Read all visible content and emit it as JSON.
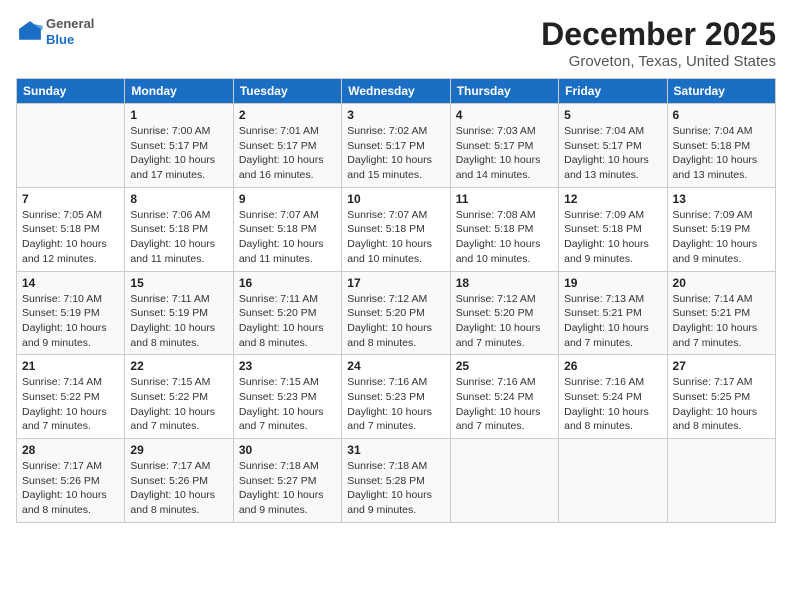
{
  "header": {
    "logo_general": "General",
    "logo_blue": "Blue",
    "title": "December 2025",
    "subtitle": "Groveton, Texas, United States"
  },
  "weekdays": [
    "Sunday",
    "Monday",
    "Tuesday",
    "Wednesday",
    "Thursday",
    "Friday",
    "Saturday"
  ],
  "weeks": [
    [
      {
        "day": "",
        "sunrise": "",
        "sunset": "",
        "daylight": ""
      },
      {
        "day": "1",
        "sunrise": "Sunrise: 7:00 AM",
        "sunset": "Sunset: 5:17 PM",
        "daylight": "Daylight: 10 hours and 17 minutes."
      },
      {
        "day": "2",
        "sunrise": "Sunrise: 7:01 AM",
        "sunset": "Sunset: 5:17 PM",
        "daylight": "Daylight: 10 hours and 16 minutes."
      },
      {
        "day": "3",
        "sunrise": "Sunrise: 7:02 AM",
        "sunset": "Sunset: 5:17 PM",
        "daylight": "Daylight: 10 hours and 15 minutes."
      },
      {
        "day": "4",
        "sunrise": "Sunrise: 7:03 AM",
        "sunset": "Sunset: 5:17 PM",
        "daylight": "Daylight: 10 hours and 14 minutes."
      },
      {
        "day": "5",
        "sunrise": "Sunrise: 7:04 AM",
        "sunset": "Sunset: 5:17 PM",
        "daylight": "Daylight: 10 hours and 13 minutes."
      },
      {
        "day": "6",
        "sunrise": "Sunrise: 7:04 AM",
        "sunset": "Sunset: 5:18 PM",
        "daylight": "Daylight: 10 hours and 13 minutes."
      }
    ],
    [
      {
        "day": "7",
        "sunrise": "Sunrise: 7:05 AM",
        "sunset": "Sunset: 5:18 PM",
        "daylight": "Daylight: 10 hours and 12 minutes."
      },
      {
        "day": "8",
        "sunrise": "Sunrise: 7:06 AM",
        "sunset": "Sunset: 5:18 PM",
        "daylight": "Daylight: 10 hours and 11 minutes."
      },
      {
        "day": "9",
        "sunrise": "Sunrise: 7:07 AM",
        "sunset": "Sunset: 5:18 PM",
        "daylight": "Daylight: 10 hours and 11 minutes."
      },
      {
        "day": "10",
        "sunrise": "Sunrise: 7:07 AM",
        "sunset": "Sunset: 5:18 PM",
        "daylight": "Daylight: 10 hours and 10 minutes."
      },
      {
        "day": "11",
        "sunrise": "Sunrise: 7:08 AM",
        "sunset": "Sunset: 5:18 PM",
        "daylight": "Daylight: 10 hours and 10 minutes."
      },
      {
        "day": "12",
        "sunrise": "Sunrise: 7:09 AM",
        "sunset": "Sunset: 5:18 PM",
        "daylight": "Daylight: 10 hours and 9 minutes."
      },
      {
        "day": "13",
        "sunrise": "Sunrise: 7:09 AM",
        "sunset": "Sunset: 5:19 PM",
        "daylight": "Daylight: 10 hours and 9 minutes."
      }
    ],
    [
      {
        "day": "14",
        "sunrise": "Sunrise: 7:10 AM",
        "sunset": "Sunset: 5:19 PM",
        "daylight": "Daylight: 10 hours and 9 minutes."
      },
      {
        "day": "15",
        "sunrise": "Sunrise: 7:11 AM",
        "sunset": "Sunset: 5:19 PM",
        "daylight": "Daylight: 10 hours and 8 minutes."
      },
      {
        "day": "16",
        "sunrise": "Sunrise: 7:11 AM",
        "sunset": "Sunset: 5:20 PM",
        "daylight": "Daylight: 10 hours and 8 minutes."
      },
      {
        "day": "17",
        "sunrise": "Sunrise: 7:12 AM",
        "sunset": "Sunset: 5:20 PM",
        "daylight": "Daylight: 10 hours and 8 minutes."
      },
      {
        "day": "18",
        "sunrise": "Sunrise: 7:12 AM",
        "sunset": "Sunset: 5:20 PM",
        "daylight": "Daylight: 10 hours and 7 minutes."
      },
      {
        "day": "19",
        "sunrise": "Sunrise: 7:13 AM",
        "sunset": "Sunset: 5:21 PM",
        "daylight": "Daylight: 10 hours and 7 minutes."
      },
      {
        "day": "20",
        "sunrise": "Sunrise: 7:14 AM",
        "sunset": "Sunset: 5:21 PM",
        "daylight": "Daylight: 10 hours and 7 minutes."
      }
    ],
    [
      {
        "day": "21",
        "sunrise": "Sunrise: 7:14 AM",
        "sunset": "Sunset: 5:22 PM",
        "daylight": "Daylight: 10 hours and 7 minutes."
      },
      {
        "day": "22",
        "sunrise": "Sunrise: 7:15 AM",
        "sunset": "Sunset: 5:22 PM",
        "daylight": "Daylight: 10 hours and 7 minutes."
      },
      {
        "day": "23",
        "sunrise": "Sunrise: 7:15 AM",
        "sunset": "Sunset: 5:23 PM",
        "daylight": "Daylight: 10 hours and 7 minutes."
      },
      {
        "day": "24",
        "sunrise": "Sunrise: 7:16 AM",
        "sunset": "Sunset: 5:23 PM",
        "daylight": "Daylight: 10 hours and 7 minutes."
      },
      {
        "day": "25",
        "sunrise": "Sunrise: 7:16 AM",
        "sunset": "Sunset: 5:24 PM",
        "daylight": "Daylight: 10 hours and 7 minutes."
      },
      {
        "day": "26",
        "sunrise": "Sunrise: 7:16 AM",
        "sunset": "Sunset: 5:24 PM",
        "daylight": "Daylight: 10 hours and 8 minutes."
      },
      {
        "day": "27",
        "sunrise": "Sunrise: 7:17 AM",
        "sunset": "Sunset: 5:25 PM",
        "daylight": "Daylight: 10 hours and 8 minutes."
      }
    ],
    [
      {
        "day": "28",
        "sunrise": "Sunrise: 7:17 AM",
        "sunset": "Sunset: 5:26 PM",
        "daylight": "Daylight: 10 hours and 8 minutes."
      },
      {
        "day": "29",
        "sunrise": "Sunrise: 7:17 AM",
        "sunset": "Sunset: 5:26 PM",
        "daylight": "Daylight: 10 hours and 8 minutes."
      },
      {
        "day": "30",
        "sunrise": "Sunrise: 7:18 AM",
        "sunset": "Sunset: 5:27 PM",
        "daylight": "Daylight: 10 hours and 9 minutes."
      },
      {
        "day": "31",
        "sunrise": "Sunrise: 7:18 AM",
        "sunset": "Sunset: 5:28 PM",
        "daylight": "Daylight: 10 hours and 9 minutes."
      },
      {
        "day": "",
        "sunrise": "",
        "sunset": "",
        "daylight": ""
      },
      {
        "day": "",
        "sunrise": "",
        "sunset": "",
        "daylight": ""
      },
      {
        "day": "",
        "sunrise": "",
        "sunset": "",
        "daylight": ""
      }
    ]
  ]
}
